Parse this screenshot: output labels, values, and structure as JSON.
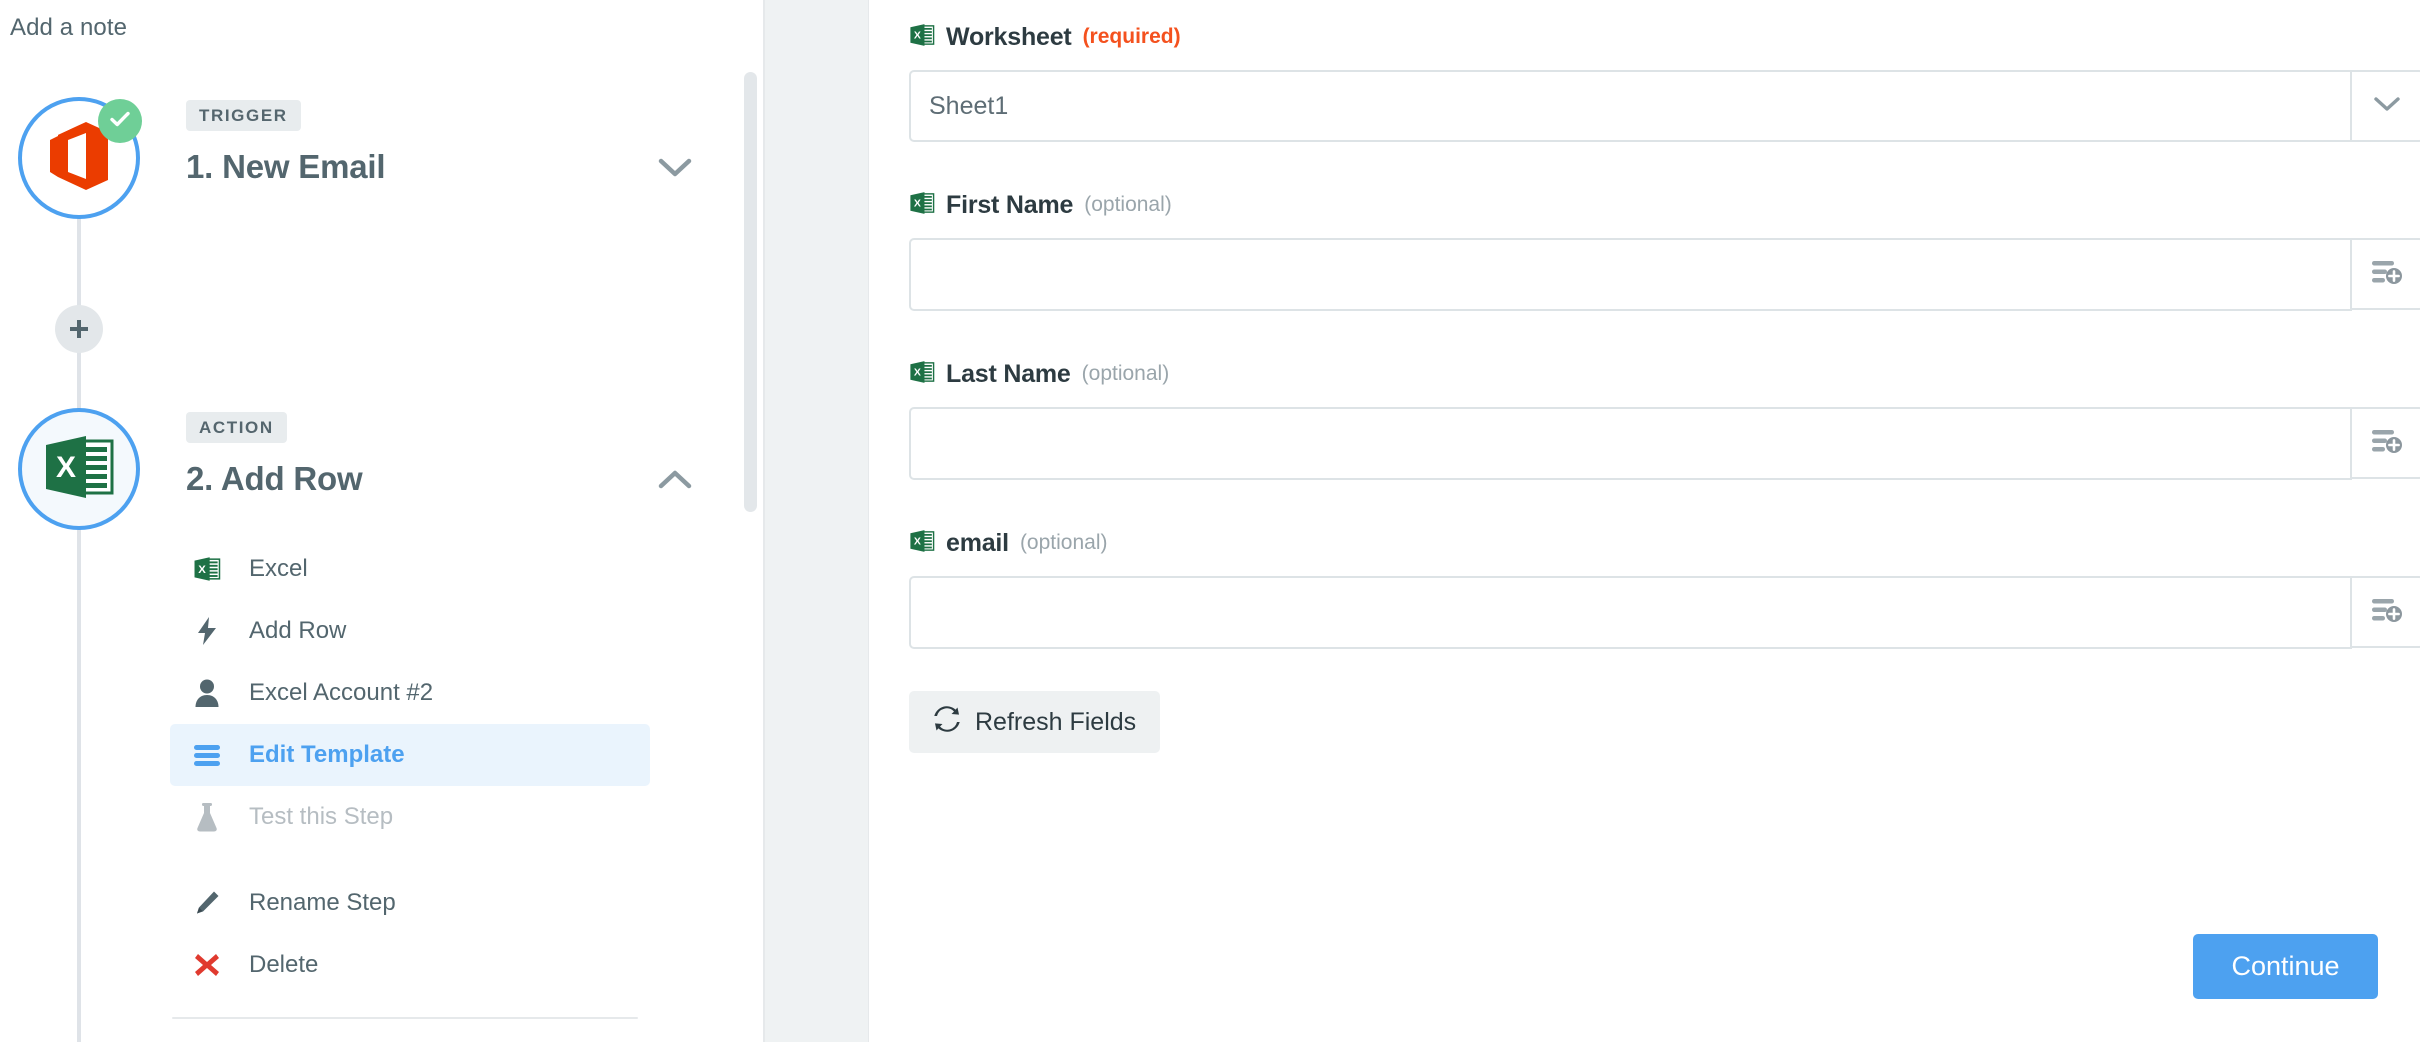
{
  "left": {
    "note_label": "Add a note",
    "steps": [
      {
        "tag": "TRIGGER",
        "title": "1. New Email",
        "app_icon": "office365-icon",
        "status": "complete",
        "chevron": "chevron-down-icon"
      },
      {
        "tag": "ACTION",
        "title": "2. Add Row",
        "app_icon": "excel-icon",
        "chevron": "chevron-up-icon"
      }
    ],
    "menu_primary": [
      {
        "label": "Excel",
        "icon": "excel-icon",
        "state": "normal"
      },
      {
        "label": "Add Row",
        "icon": "bolt-icon",
        "state": "normal"
      },
      {
        "label": "Excel Account #2",
        "icon": "user-icon",
        "state": "normal"
      },
      {
        "label": "Edit Template",
        "icon": "list-lines-icon",
        "state": "active"
      },
      {
        "label": "Test this Step",
        "icon": "flask-icon",
        "state": "disabled"
      }
    ],
    "menu_secondary": [
      {
        "label": "Rename Step",
        "icon": "pencil-icon",
        "state": "normal"
      },
      {
        "label": "Delete",
        "icon": "x-mark-icon",
        "state": "normal"
      }
    ],
    "add_step_icon": "plus-icon"
  },
  "right": {
    "fields": [
      {
        "label": "Worksheet",
        "qualifier": "(required)",
        "qualifier_type": "required",
        "icon": "excel-icon",
        "value": "Sheet1",
        "placeholder": "",
        "addon": "chevron-down-icon",
        "control": "select"
      },
      {
        "label": "First Name",
        "qualifier": "(optional)",
        "qualifier_type": "optional",
        "icon": "excel-icon",
        "value": "",
        "placeholder": "",
        "addon": "insert-field-icon",
        "control": "text"
      },
      {
        "label": "Last Name",
        "qualifier": "(optional)",
        "qualifier_type": "optional",
        "icon": "excel-icon",
        "value": "",
        "placeholder": "",
        "addon": "insert-field-icon",
        "control": "text"
      },
      {
        "label": "email",
        "qualifier": "(optional)",
        "qualifier_type": "optional",
        "icon": "excel-icon",
        "value": "",
        "placeholder": "",
        "addon": "insert-field-icon",
        "control": "text"
      }
    ],
    "refresh_button": {
      "label": "Refresh Fields",
      "icon": "refresh-icon"
    },
    "continue_button": {
      "label": "Continue"
    }
  },
  "colors": {
    "accent_blue": "#4da1f0",
    "success_green": "#6fcf97",
    "required_orange": "#f4511e",
    "excel_green": "#1e7145",
    "office_orange": "#eb3c00",
    "delete_red": "#e03a2f",
    "text_slate": "#53666e",
    "muted_gray": "#9aa5ab",
    "gutter_gray": "#eff2f3"
  }
}
